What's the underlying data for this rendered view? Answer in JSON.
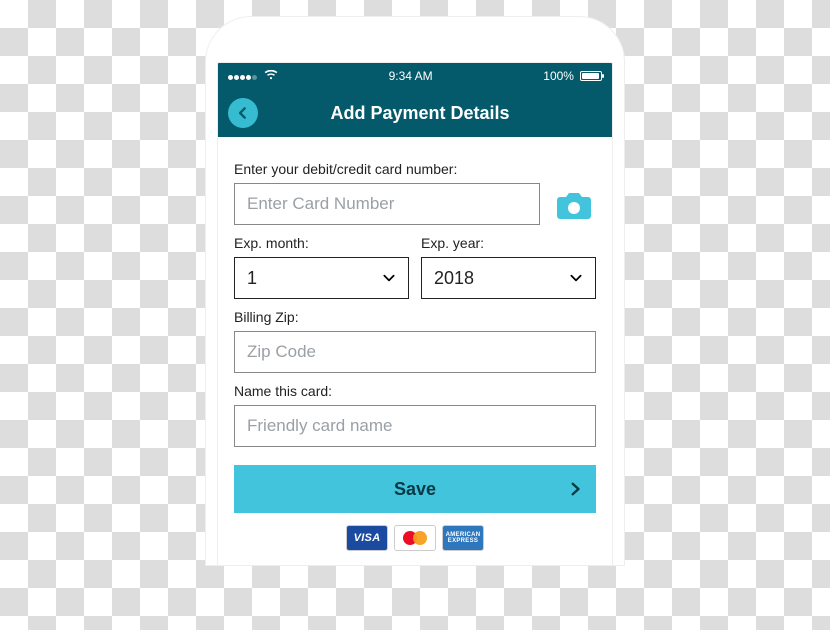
{
  "statusbar": {
    "time": "9:34 AM",
    "battery_pct": "100%"
  },
  "header": {
    "title": "Add Payment Details",
    "back_icon": "chevron-left-icon"
  },
  "form": {
    "card_number_label": "Enter your debit/credit card number:",
    "card_number_placeholder": "Enter Card Number",
    "camera_icon": "camera-icon",
    "exp_month_label": "Exp. month:",
    "exp_month_value": "1",
    "exp_year_label": "Exp. year:",
    "exp_year_value": "2018",
    "billing_zip_label": "Billing Zip:",
    "billing_zip_placeholder": "Zip Code",
    "name_card_label": "Name this card:",
    "name_card_placeholder": "Friendly card name",
    "save_label": "Save"
  },
  "logos": {
    "visa": "VISA",
    "mastercard": "MasterCard",
    "amex_line1": "AMERICAN",
    "amex_line2": "EXPRESS"
  },
  "colors": {
    "header_bg": "#045a6b",
    "accent": "#43c4dd"
  }
}
